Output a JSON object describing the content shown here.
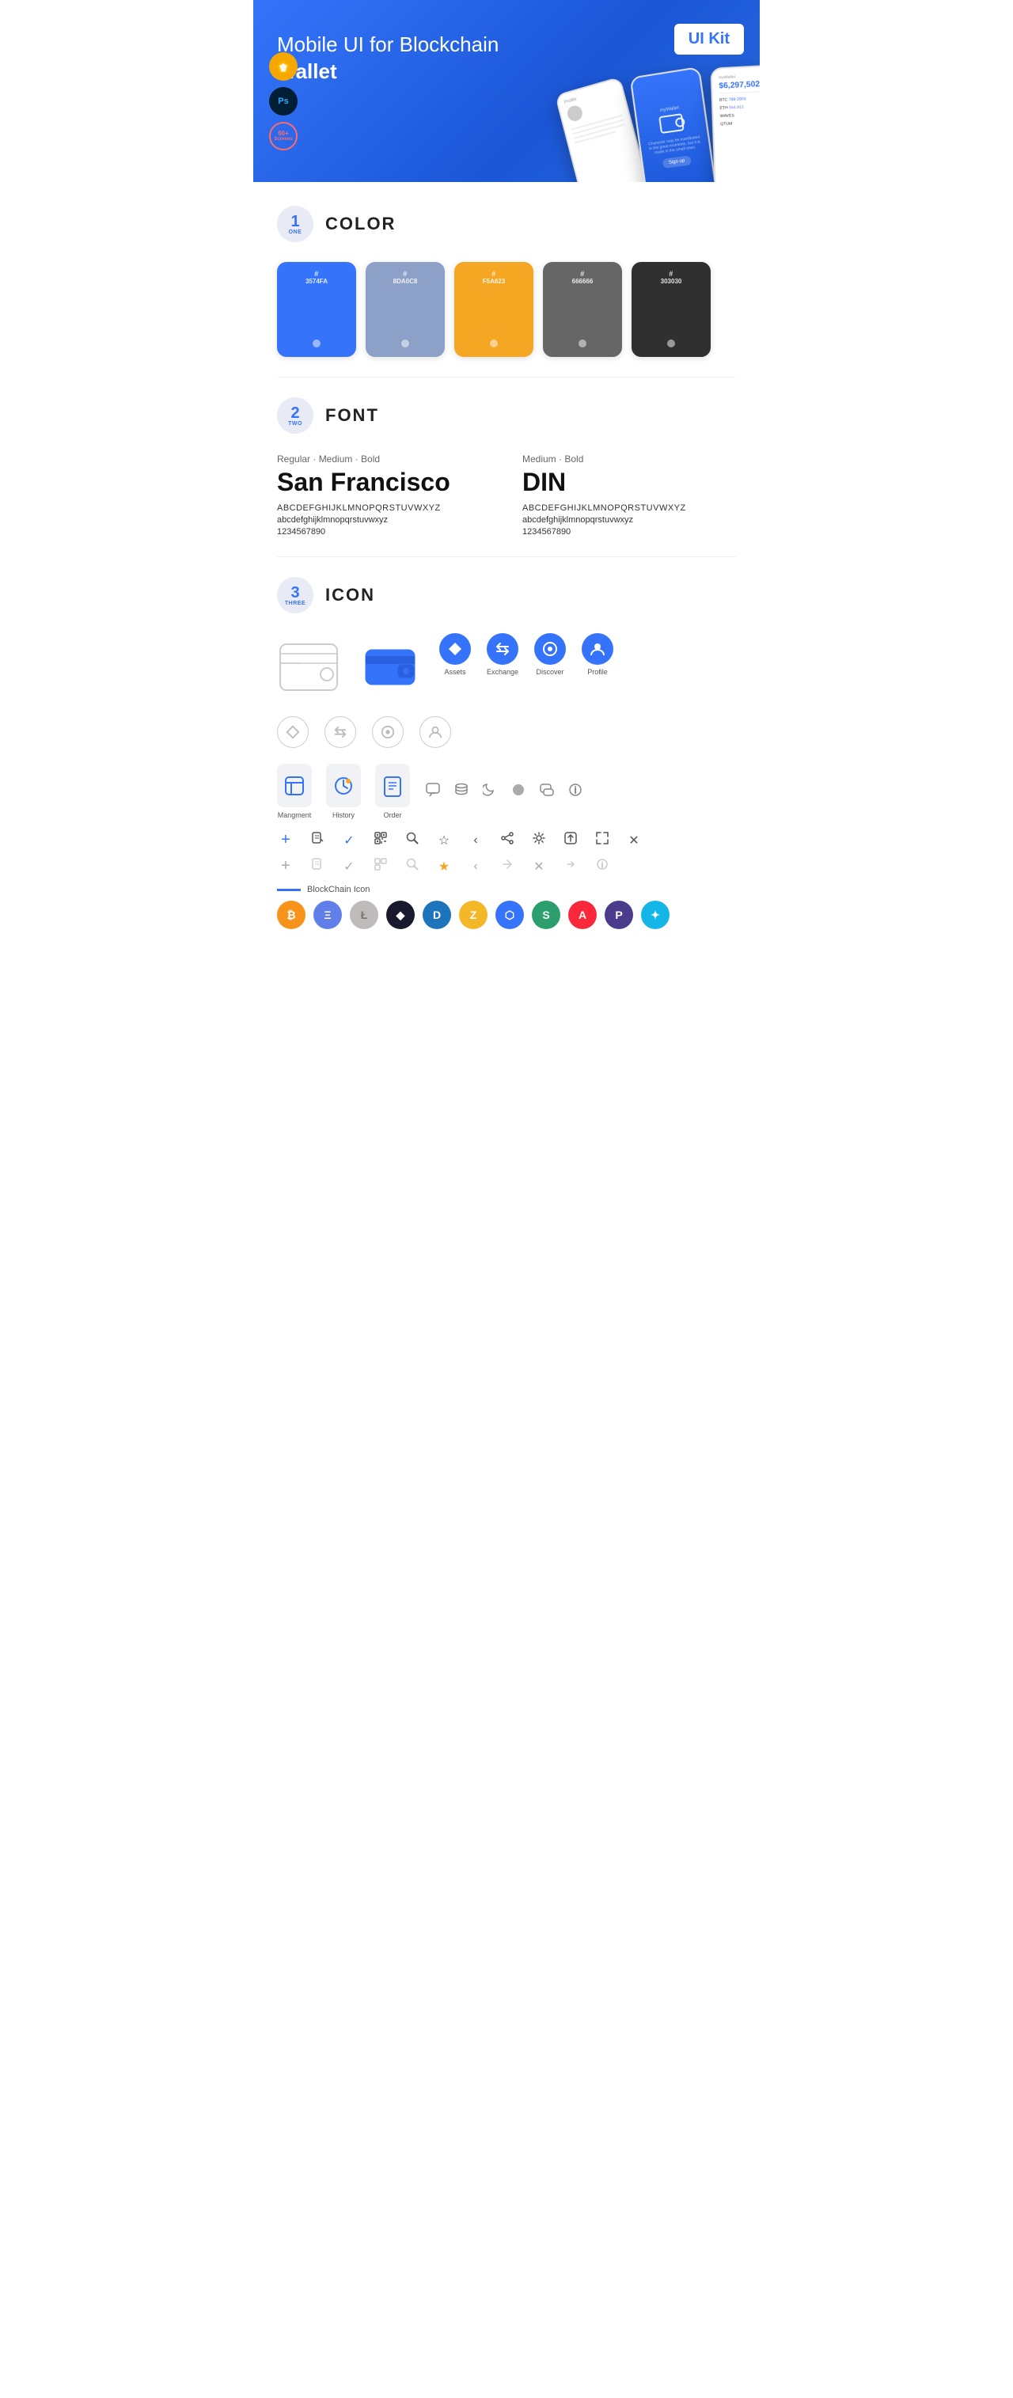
{
  "hero": {
    "title": "Mobile UI for Blockchain ",
    "title_bold": "Wallet",
    "ui_kit_badge": "UI Kit",
    "badge_sketch": "◈",
    "badge_ps": "Ps",
    "badge_screens_top": "60+",
    "badge_screens_bottom": "Screens"
  },
  "sections": {
    "color": {
      "number": "1",
      "word": "ONE",
      "title": "COLOR",
      "swatches": [
        {
          "hex": "#3574FA",
          "label": "3574FA"
        },
        {
          "hex": "#8DA0C8",
          "label": "8DA0C8"
        },
        {
          "hex": "#F5A623",
          "label": "F5A623"
        },
        {
          "hex": "#666666",
          "label": "666666"
        },
        {
          "hex": "#303030",
          "label": "303030"
        }
      ]
    },
    "font": {
      "number": "2",
      "word": "TWO",
      "title": "FONT",
      "fonts": [
        {
          "weights": "Regular · Medium · Bold",
          "name": "San Francisco",
          "upper": "ABCDEFGHIJKLMNOPQRSTUVWXYZ",
          "lower": "abcdefghijklmnopqrstuvwxyz",
          "numbers": "1234567890"
        },
        {
          "weights": "Medium · Bold",
          "name": "DIN",
          "upper": "ABCDEFGHIJKLMNOPQRSTUVWXYZ",
          "lower": "abcdefghijklmnopqrstuvwxyz",
          "numbers": "1234567890"
        }
      ]
    },
    "icon": {
      "number": "3",
      "word": "THREE",
      "title": "ICON",
      "nav_items": [
        {
          "label": "Assets",
          "icon": "◆"
        },
        {
          "label": "Exchange",
          "icon": "⇄"
        },
        {
          "label": "Discover",
          "icon": "●"
        },
        {
          "label": "Profile",
          "icon": "⌀"
        }
      ],
      "app_icons": [
        {
          "label": "Mangment",
          "icon": "▤"
        },
        {
          "label": "History",
          "icon": "◷"
        },
        {
          "label": "Order",
          "icon": "≡"
        }
      ],
      "utility_icons_row1": [
        "＋",
        "▤",
        "✓",
        "⊞",
        "⌕",
        "☆",
        "‹",
        "‹",
        "⚙",
        "⊡",
        "⇄",
        "✕"
      ],
      "blockchain_label": "BlockChain Icon",
      "crypto_icons": [
        {
          "label": "BTC",
          "color": "#F7931A",
          "symbol": "₿"
        },
        {
          "label": "ETH",
          "color": "#627EEA",
          "symbol": "Ξ"
        },
        {
          "label": "LTC",
          "color": "#BFBBBB",
          "symbol": "Ł"
        },
        {
          "label": "WINGS",
          "color": "#1A1A2E",
          "symbol": "▲"
        },
        {
          "label": "DASH",
          "color": "#1C75BC",
          "symbol": "D"
        },
        {
          "label": "ZEC",
          "color": "#F4B728",
          "symbol": "Z"
        },
        {
          "label": "GRID",
          "color": "#3574FA",
          "symbol": "⬡"
        },
        {
          "label": "STRAT",
          "color": "#2d9f6e",
          "symbol": "S"
        },
        {
          "label": "ARK",
          "color": "#F9283B",
          "symbol": "A"
        },
        {
          "label": "POLY",
          "color": "#4B3B8C",
          "symbol": "P"
        },
        {
          "label": "XLM",
          "color": "#14B6E7",
          "symbol": "✦"
        }
      ]
    }
  }
}
